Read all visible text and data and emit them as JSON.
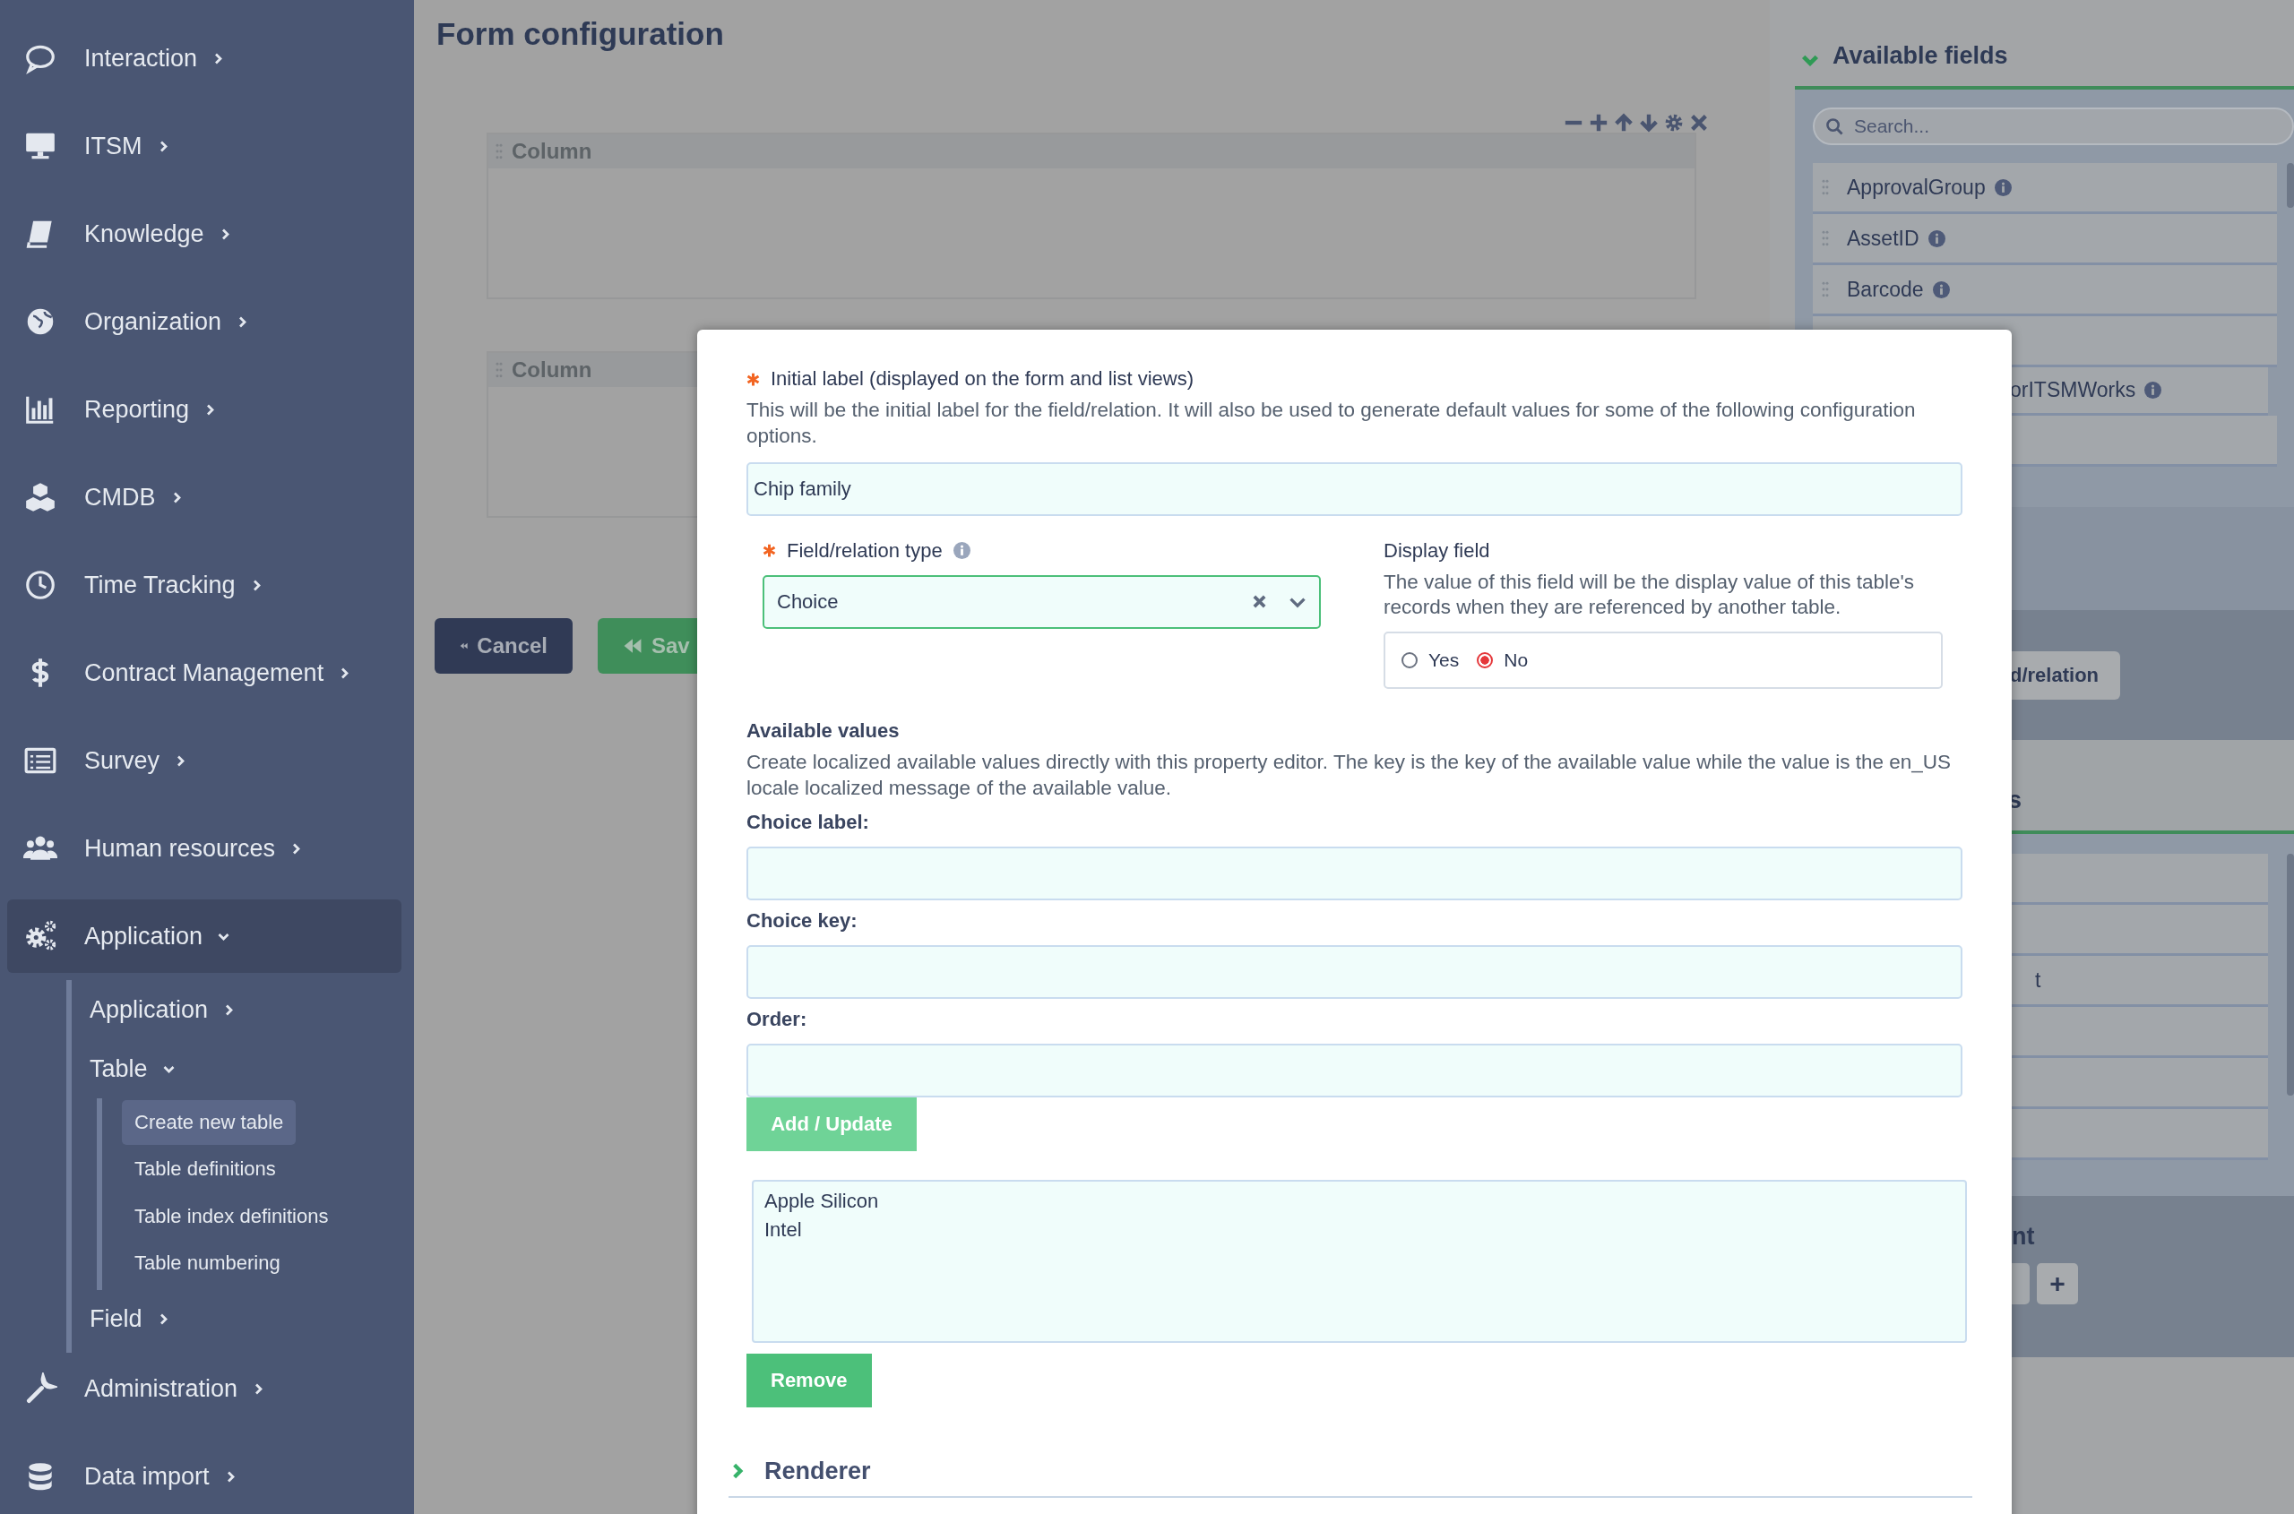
{
  "sidebar": {
    "items": [
      {
        "label": "Interaction",
        "expanded": false,
        "selected": false
      },
      {
        "label": "ITSM",
        "expanded": false,
        "selected": false
      },
      {
        "label": "Knowledge",
        "expanded": false,
        "selected": false
      },
      {
        "label": "Organization",
        "expanded": false,
        "selected": false
      },
      {
        "label": "Reporting",
        "expanded": false,
        "selected": false
      },
      {
        "label": "CMDB",
        "expanded": false,
        "selected": false
      },
      {
        "label": "Time Tracking",
        "expanded": false,
        "selected": false
      },
      {
        "label": "Contract Management",
        "expanded": false,
        "selected": false
      },
      {
        "label": "Survey",
        "expanded": false,
        "selected": false
      },
      {
        "label": "Human resources",
        "expanded": false,
        "selected": false
      },
      {
        "label": "Application",
        "expanded": true,
        "selected": true,
        "children": [
          {
            "label": "Application",
            "expanded": false
          },
          {
            "label": "Table",
            "expanded": true,
            "children": [
              {
                "label": "Create new table",
                "selected": true
              },
              {
                "label": "Table definitions",
                "selected": false
              },
              {
                "label": "Table index definitions",
                "selected": false
              },
              {
                "label": "Table numbering",
                "selected": false
              }
            ]
          },
          {
            "label": "Field",
            "expanded": false
          }
        ]
      },
      {
        "label": "Administration",
        "expanded": false,
        "selected": false
      },
      {
        "label": "Data import",
        "expanded": false,
        "selected": false
      }
    ]
  },
  "main": {
    "title": "Form configuration",
    "columns": [
      {
        "title": "Column"
      },
      {
        "title": "Column"
      }
    ],
    "buttons": [
      {
        "label": "Cancel",
        "kind": "cancel"
      },
      {
        "label": "Sav",
        "kind": "save"
      }
    ]
  },
  "right_panel": {
    "title": "Available fields",
    "expanded": true,
    "search": {
      "placeholder": "Search..."
    },
    "fields": [
      {
        "label": "ApprovalGroup",
        "info": true,
        "kind": "full"
      },
      {
        "label": "AssetID",
        "info": true,
        "kind": "full"
      },
      {
        "label": "Barcode",
        "info": true,
        "kind": "full"
      },
      {
        "kind": "covered"
      },
      {
        "label": "orITSMWorks",
        "info": true,
        "kind": "partial"
      },
      {
        "kind": "covered"
      }
    ],
    "add_button": {
      "label": "d/relation"
    },
    "section_2": {
      "title": "s",
      "rows": [
        {
          "kind": "covered"
        },
        {
          "kind": "covered"
        },
        {
          "label": "t",
          "kind": "partial"
        },
        {
          "kind": "covered"
        },
        {
          "kind": "covered"
        },
        {
          "kind": "covered"
        }
      ]
    },
    "section_3": {
      "title": "nt",
      "buttons": [
        {
          "kind": "covered"
        },
        {
          "label": "+",
          "kind": "add"
        }
      ]
    }
  },
  "dialog": {
    "initial_label": {
      "label": "Initial label (displayed on the form and list views)",
      "required": true,
      "help": "This will be the initial label for the field/relation. It will also be used to generate default values for some of the following configuration options.",
      "value": "Chip family"
    },
    "field_type": {
      "label": "Field/relation type",
      "required": true,
      "info": true,
      "value": "Choice"
    },
    "display_field": {
      "label": "Display field",
      "help": "The value of this field will be the display value of this table's records when they are referenced by another table.",
      "options": [
        {
          "label": "Yes",
          "selected": false
        },
        {
          "label": "No",
          "selected": true
        }
      ]
    },
    "available_values": {
      "title": "Available values",
      "help": "Create localized available values directly with this property editor. The key is the key of the available value while the value is the en_US locale localized message of the available value.",
      "inputs": [
        {
          "label": "Choice label:"
        },
        {
          "label": "Choice key:"
        },
        {
          "label": "Order:"
        }
      ],
      "add_button": "Add / Update",
      "values": [
        "Apple Silicon",
        "Intel"
      ],
      "remove_button": "Remove"
    },
    "sections": [
      {
        "title": "Renderer",
        "expanded": false
      }
    ]
  }
}
